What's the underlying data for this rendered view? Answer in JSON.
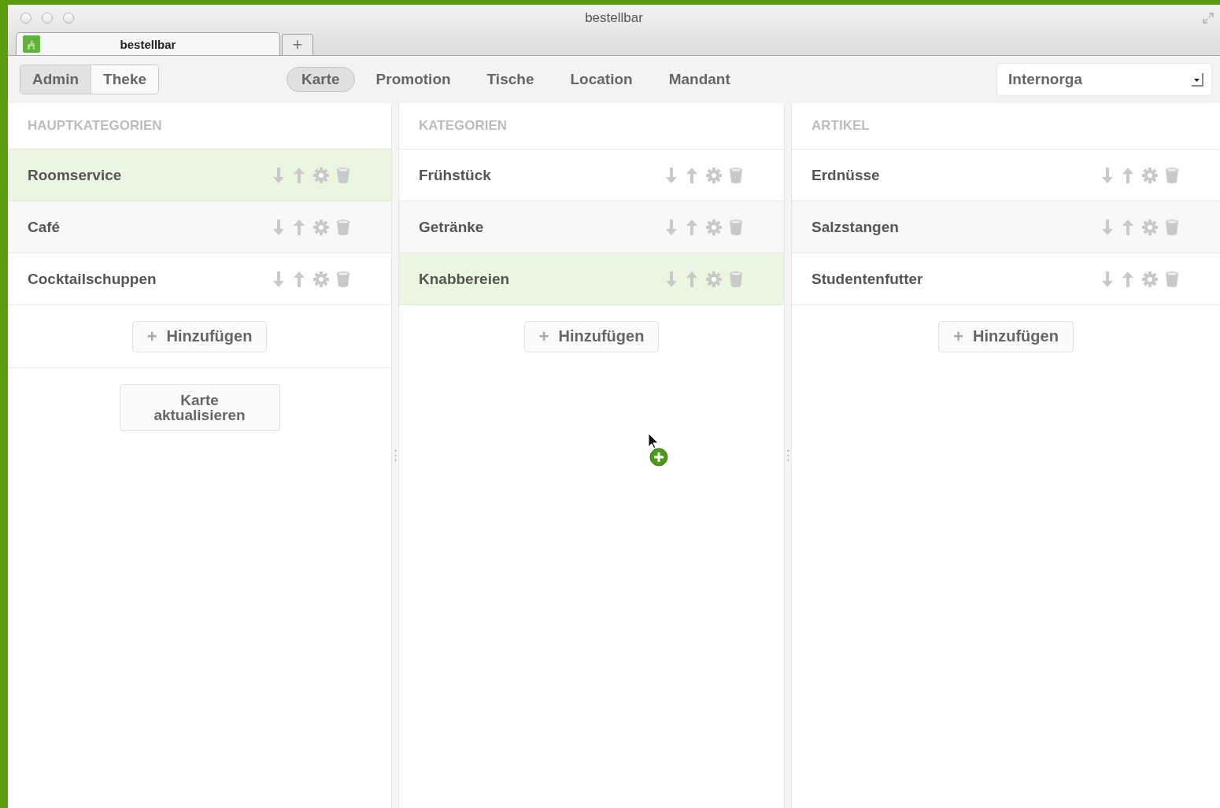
{
  "window": {
    "title": "bestellbar"
  },
  "browser_tabs": [
    {
      "label": "bestellbar",
      "selected": true
    }
  ],
  "new_tab": "+",
  "mode_switch": [
    {
      "label": "Admin",
      "selected": true
    },
    {
      "label": "Theke",
      "selected": false
    }
  ],
  "nav": [
    {
      "label": "Karte",
      "selected": true
    },
    {
      "label": "Promotion",
      "selected": false
    },
    {
      "label": "Tische",
      "selected": false
    },
    {
      "label": "Location",
      "selected": false
    },
    {
      "label": "Mandant",
      "selected": false
    }
  ],
  "client_select": {
    "value": "Internorga"
  },
  "columns": [
    {
      "title": "HAUPTKATEGORIEN",
      "items": [
        {
          "name": "Roomservice",
          "selected": true
        },
        {
          "name": "Café",
          "selected": false
        },
        {
          "name": "Cocktailschuppen",
          "selected": false
        }
      ],
      "add_label": "Hinzufügen",
      "add_icon": "+",
      "extra_button": "Karte\naktualisieren"
    },
    {
      "title": "KATEGORIEN",
      "items": [
        {
          "name": "Frühstück",
          "selected": false
        },
        {
          "name": "Getränke",
          "selected": false
        },
        {
          "name": "Knabbereien",
          "selected": true
        }
      ],
      "add_label": "Hinzufügen",
      "add_icon": "+"
    },
    {
      "title": "ARTIKEL",
      "items": [
        {
          "name": "Erdnüsse",
          "selected": false
        },
        {
          "name": "Salzstangen",
          "selected": false
        },
        {
          "name": "Studentenfutter",
          "selected": false
        }
      ],
      "add_label": "Hinzufügen",
      "add_icon": "+"
    }
  ]
}
